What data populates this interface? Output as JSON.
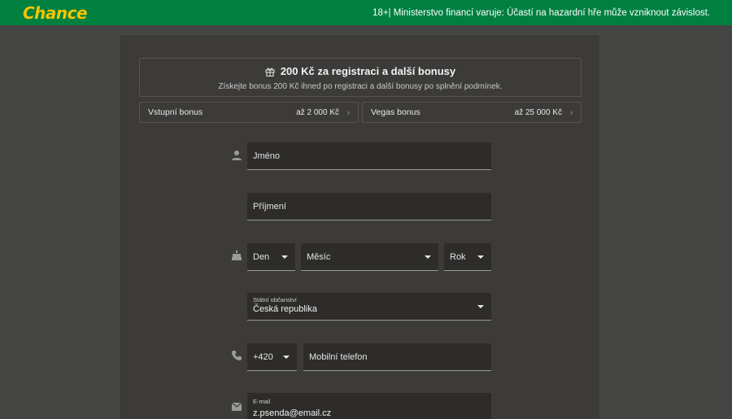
{
  "header": {
    "logo_text": "Chance",
    "warning": "18+| Ministerstvo financí varuje: Účastí na hazardní hře může vzniknout závislost."
  },
  "bonus": {
    "title": "200 Kč za registraci a další bonusy",
    "subtitle": "Získejte bonus 200 Kč ihned po registraci a další bonusy po splnění podmínek.",
    "tiles": [
      {
        "label": "Vstupní bonus",
        "value": "až 2 000 Kč"
      },
      {
        "label": "Vegas bonus",
        "value": "až 25 000 Kč"
      }
    ]
  },
  "form": {
    "first_name_placeholder": "Jméno",
    "last_name_placeholder": "Příjmení",
    "birth": {
      "day": "Den",
      "month": "Měsíc",
      "year": "Rok"
    },
    "citizenship": {
      "label": "Státní občanství",
      "value": "Česká republika"
    },
    "phone": {
      "prefix": "+420",
      "placeholder": "Mobilní telefon"
    },
    "email": {
      "label": "E-mail",
      "value": "z.psenda@email.cz"
    }
  },
  "colors": {
    "brand_green": "#00803f",
    "logo_yellow": "#f5c400",
    "background": "#444442",
    "panel": "#3c3b39",
    "field": "#2d2c2a"
  }
}
